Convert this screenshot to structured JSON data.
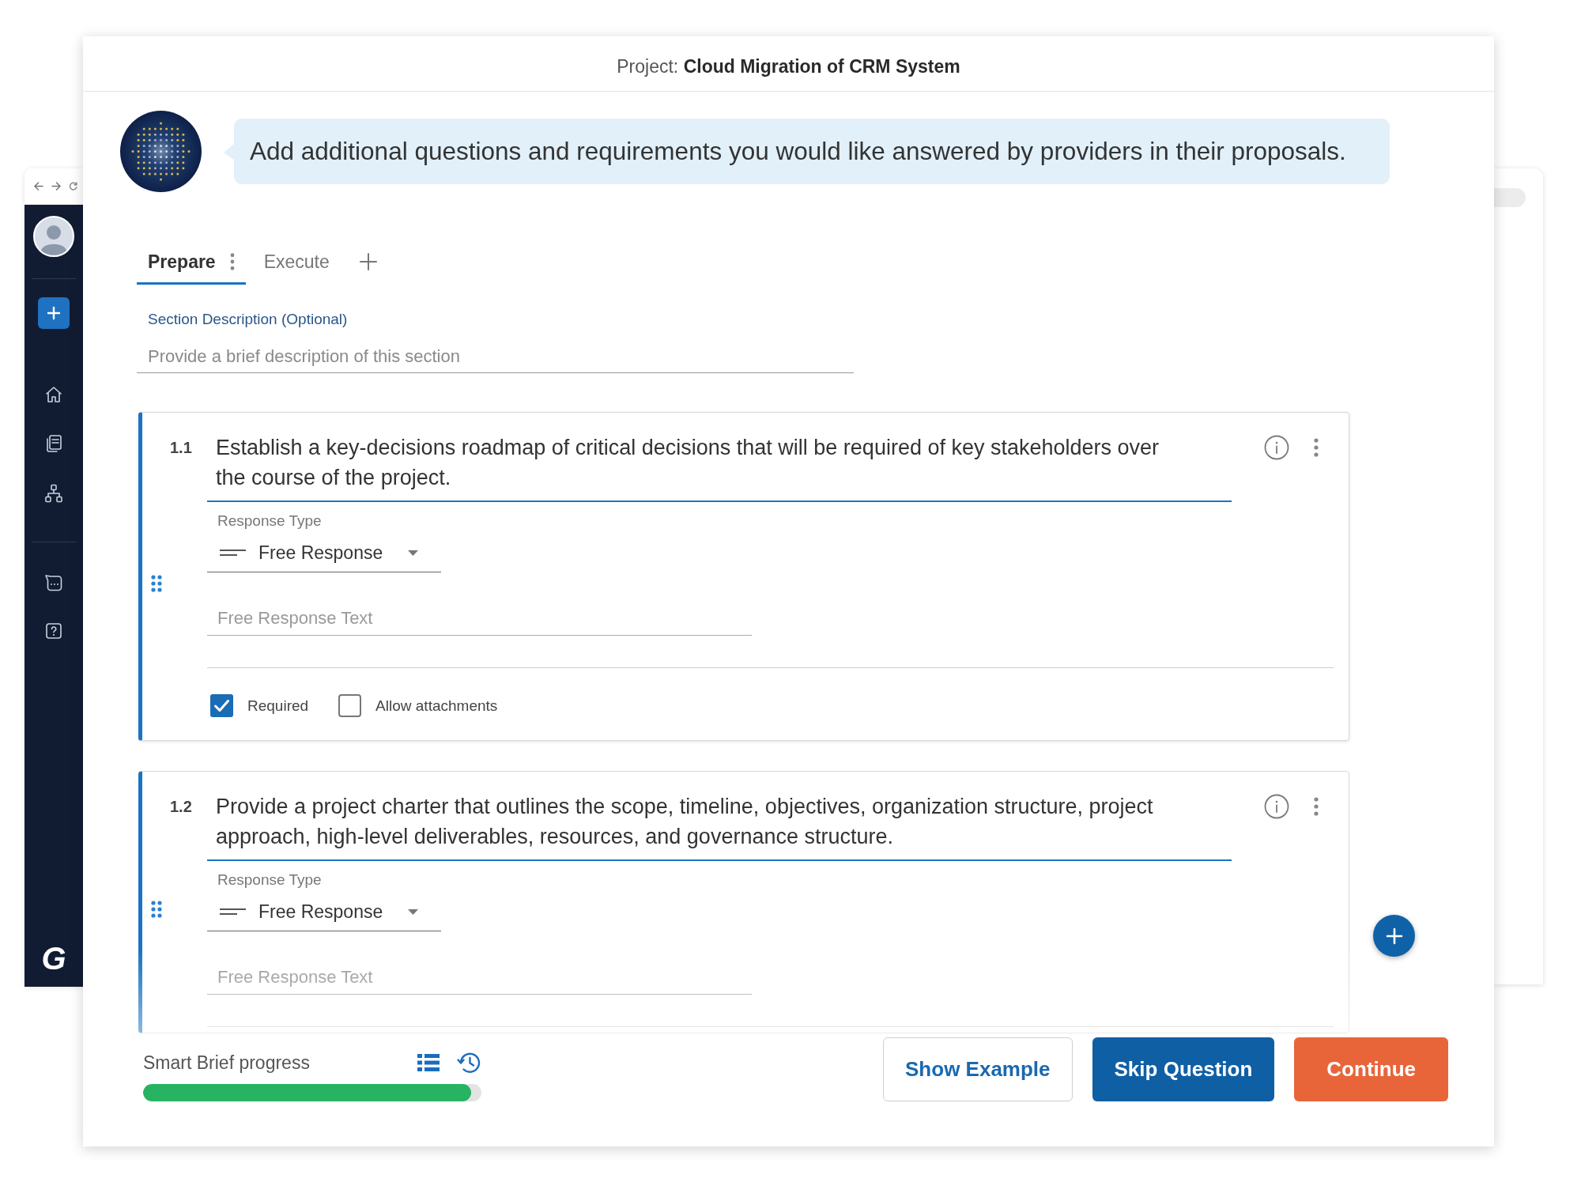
{
  "sidebar": {
    "logo": "G"
  },
  "window": {
    "header": "Project: **Cloud Migration of CRM System**"
  },
  "assistant": {
    "message": "Add additional questions and requirements you would like answered by providers in their proposals."
  },
  "tabs": [
    {
      "label": "Prepare",
      "selected": true
    },
    {
      "label": "Execute",
      "selected": false
    }
  ],
  "section_description": {
    "label": "Section Description (Optional)",
    "placeholder": "Provide a brief description of this section"
  },
  "questions": [
    {
      "number": "1.1",
      "text": "Establish a key-decisions roadmap of critical decisions that will be required of key stakeholders over the course of the project.",
      "response_type_label": "Response Type",
      "response_type": "Free Response",
      "placeholder": "Free Response Text",
      "faded": false,
      "options": [
        {
          "label": "Required",
          "checked": true
        },
        {
          "label": "Allow attachments",
          "checked": false
        }
      ]
    },
    {
      "number": "1.2",
      "text": "Provide a project charter that outlines the scope, timeline, objectives, organization structure, project approach, high-level deliverables, resources, and governance structure.",
      "response_type_label": "Response Type",
      "response_type": "Free Response",
      "placeholder": "Free Response Text",
      "faded": true
    }
  ],
  "progress": {
    "label": "Smart Brief progress",
    "level": 0.97
  },
  "buttons": [
    {
      "label": "Show Example",
      "kind": "outline"
    },
    {
      "label": "Skip Question",
      "kind": "primary"
    },
    {
      "label": "Continue",
      "kind": "accent"
    }
  ]
}
